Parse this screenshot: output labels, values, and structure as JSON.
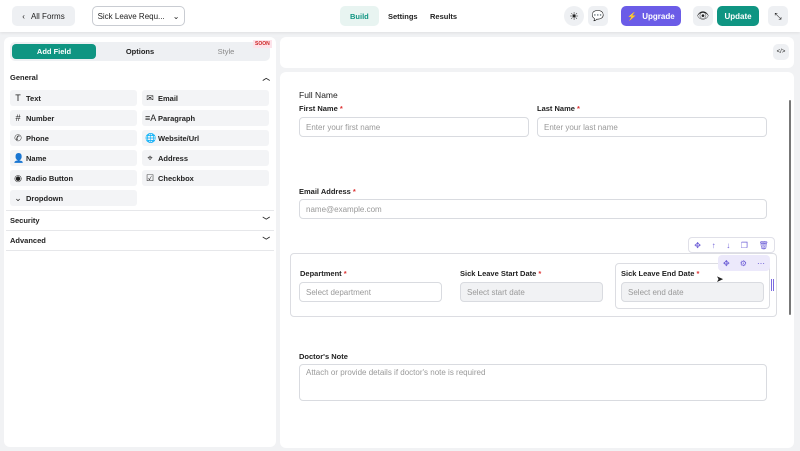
{
  "header": {
    "back_label": "All Forms",
    "form_select": "Sick Leave Requ...",
    "tabs": [
      "Build",
      "Settings",
      "Results"
    ],
    "upgrade_label": "Upgrade",
    "update_label": "Update"
  },
  "sidebar": {
    "tabs": [
      "Add Field",
      "Options",
      "Style"
    ],
    "soon_badge": "SOON",
    "general": "General",
    "fields": [
      {
        "label": "Text",
        "icon": "T"
      },
      {
        "label": "Email",
        "icon": "✉"
      },
      {
        "label": "Number",
        "icon": "#"
      },
      {
        "label": "Paragraph",
        "icon": "≡A"
      },
      {
        "label": "Phone",
        "icon": "✆"
      },
      {
        "label": "Website/Url",
        "icon": "🌐"
      },
      {
        "label": "Name",
        "icon": "👤"
      },
      {
        "label": "Address",
        "icon": "⌖"
      },
      {
        "label": "Radio Button",
        "icon": "◉"
      },
      {
        "label": "Checkbox",
        "icon": "☑"
      },
      {
        "label": "Dropdown",
        "icon": "⌄"
      }
    ],
    "security": "Security",
    "advanced": "Advanced"
  },
  "form": {
    "full_name": "Full Name",
    "first_name_label": "First Name",
    "first_name_ph": "Enter your first name",
    "last_name_label": "Last Name",
    "last_name_ph": "Enter your last name",
    "email_label": "Email Address",
    "email_ph": "name@example.com",
    "department_label": "Department",
    "department_ph": "Select department",
    "start_label": "Sick Leave Start Date",
    "start_ph": "Select start date",
    "end_label": "Sick Leave End Date",
    "end_ph": "Select end date",
    "note_label": "Doctor's Note",
    "note_ph": "Attach or provide details if doctor's note is required",
    "required": "*"
  },
  "colors": {
    "primary": "#0f9582",
    "upgrade": "#6b5ce7",
    "accent_toolbar": "#6b5cd6"
  }
}
